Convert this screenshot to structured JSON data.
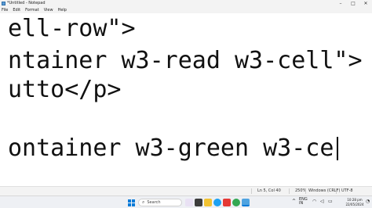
{
  "window": {
    "title": "*Untitled - Notepad"
  },
  "menu": [
    "File",
    "Edit",
    "Format",
    "View",
    "Help"
  ],
  "editor": {
    "lines": [
      "ell-row\">",
      "ntainer w3-read w3-cell\">",
      "utto</p>",
      "",
      "ontainer w3-green w3-ce"
    ]
  },
  "statusbar": {
    "position": "Ln 5, Col 40",
    "zoom": "250%",
    "line_ending": "Windows (CRLF)",
    "encoding": "UTF-8"
  },
  "taskbar": {
    "search_placeholder": "Search",
    "language": "ENG",
    "region": "IN",
    "time": "10:28 pm",
    "date": "22/05/2024"
  }
}
